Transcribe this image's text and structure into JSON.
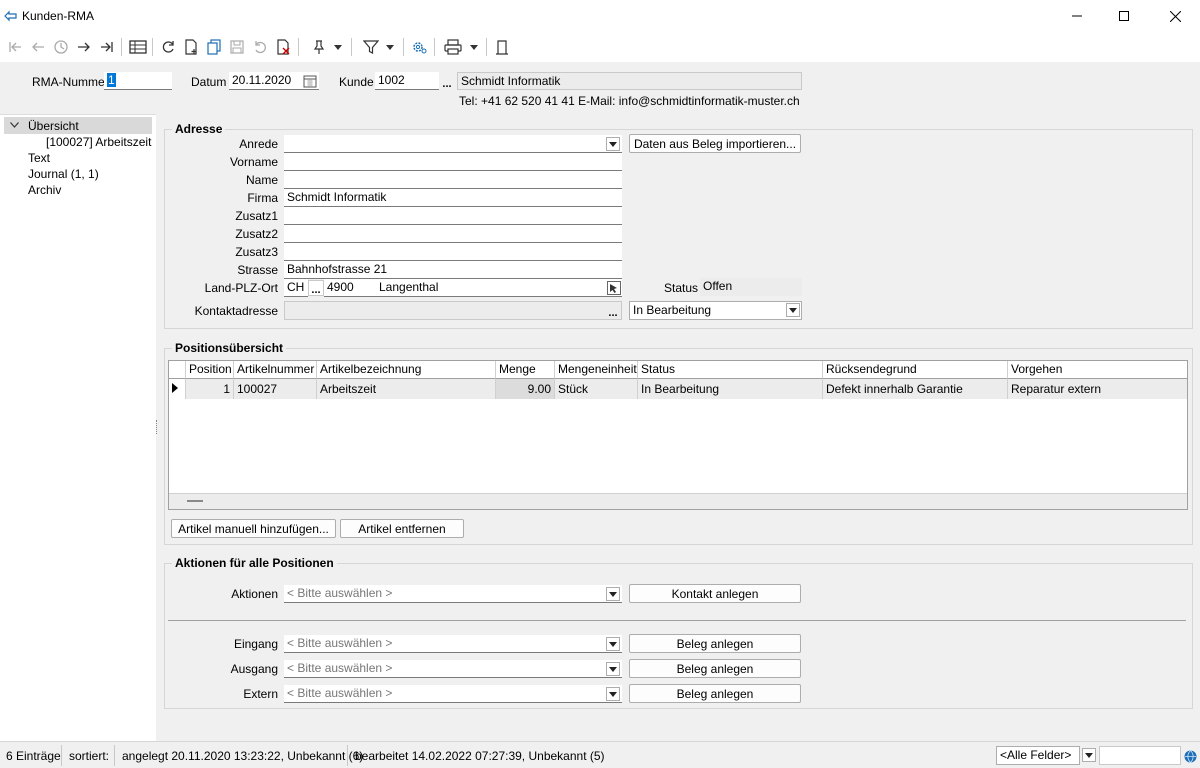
{
  "window": {
    "title": "Kunden-RMA"
  },
  "header": {
    "rma_label": "RMA-Nummer",
    "rma_value": "1",
    "datum_label": "Datum",
    "datum_value": "20.11.2020",
    "kunde_label": "Kunde",
    "kunde_value": "1002",
    "kunde_name": "Schmidt Informatik",
    "contact_line": "Tel: +41 62 520 41 41   E-Mail: info@schmidtinformatik-muster.ch"
  },
  "tree": {
    "items": [
      {
        "label": "Übersicht"
      },
      {
        "label": "[100027]  Arbeitszeit"
      },
      {
        "label": "Text"
      },
      {
        "label": "Journal (1, 1)"
      },
      {
        "label": "Archiv"
      }
    ]
  },
  "adresse": {
    "title": "Adresse",
    "anrede_label": "Anrede",
    "anrede_value": "",
    "vorname_label": "Vorname",
    "vorname_value": "",
    "name_label": "Name",
    "name_value": "",
    "firma_label": "Firma",
    "firma_value": "Schmidt Informatik",
    "zusatz1_label": "Zusatz1",
    "zusatz1_value": "",
    "zusatz2_label": "Zusatz2",
    "zusatz2_value": "",
    "zusatz3_label": "Zusatz3",
    "zusatz3_value": "",
    "strasse_label": "Strasse",
    "strasse_value": "Bahnhofstrasse 21",
    "land_label": "Land-PLZ-Ort",
    "land_value": "CH",
    "plz_value": "4900",
    "ort_value": "Langenthal",
    "kontakt_label": "Kontaktadresse",
    "kontakt_value": "",
    "import_button": "Daten aus Beleg importieren...",
    "status_label": "Status",
    "status_value": "Offen",
    "bearbeitung_value": "In Bearbeitung"
  },
  "positions": {
    "title": "Positionsübersicht",
    "columns": [
      "Position",
      "Artikelnummer",
      "Artikelbezeichnung",
      "Menge",
      "Mengeneinheit",
      "Status",
      "Rücksendegrund",
      "Vorgehen"
    ],
    "rows": [
      [
        "1",
        "100027",
        "Arbeitszeit",
        "9.00",
        "Stück",
        "In Bearbeitung",
        "Defekt innerhalb Garantie",
        "Reparatur extern"
      ]
    ],
    "add_button": "Artikel manuell hinzufügen...",
    "remove_button": "Artikel entfernen"
  },
  "aktionen": {
    "title": "Aktionen für alle Positionen",
    "aktionen_label": "Aktionen",
    "aktionen_placeholder": "< Bitte auswählen >",
    "kontakt_button": "Kontakt anlegen",
    "eingang_label": "Eingang",
    "eingang_placeholder": "< Bitte auswählen >",
    "ausgang_label": "Ausgang",
    "ausgang_placeholder": "< Bitte auswählen >",
    "extern_label": "Extern",
    "extern_placeholder": "< Bitte auswählen >",
    "beleg_button": "Beleg anlegen"
  },
  "statusbar": {
    "count": "6 Einträge",
    "sorted": "sortiert:",
    "created": "angelegt 20.11.2020 13:23:22, Unbekannt (6)",
    "edited": "bearbeitet 14.02.2022 07:27:39, Unbekannt (5)",
    "filter_value": "<Alle Felder>"
  },
  "colors": {
    "accent": "#0078d7",
    "grid_selected": "#ececec",
    "icon_blue": "#1f6fb5"
  }
}
